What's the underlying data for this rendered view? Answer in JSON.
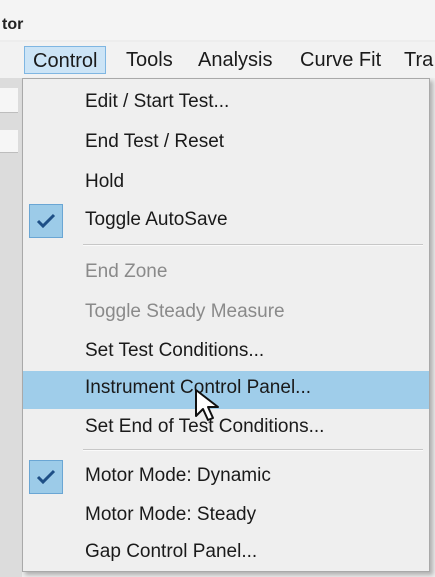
{
  "window": {
    "title_fragment": "tor"
  },
  "menubar": {
    "items": [
      {
        "label": "Control",
        "active": true
      },
      {
        "label": "Tools"
      },
      {
        "label": "Analysis"
      },
      {
        "label": "Curve Fit"
      },
      {
        "label": "Tra"
      }
    ]
  },
  "control_menu": {
    "items": [
      {
        "label": "Edit / Start Test...",
        "enabled": true
      },
      {
        "label": "End Test / Reset",
        "enabled": true
      },
      {
        "label": "Hold",
        "enabled": true
      },
      {
        "label": "Toggle AutoSave",
        "enabled": true,
        "checked": true
      },
      {
        "label": "End Zone",
        "enabled": false
      },
      {
        "label": "Toggle Steady Measure",
        "enabled": false
      },
      {
        "label": "Set Test Conditions...",
        "enabled": true
      },
      {
        "label": "Instrument Control Panel...",
        "enabled": true,
        "highlighted": true
      },
      {
        "label": "Set End of Test Conditions...",
        "enabled": true
      },
      {
        "label": "Motor Mode: Dynamic",
        "enabled": true,
        "checked": true
      },
      {
        "label": "Motor Mode: Steady",
        "enabled": true
      },
      {
        "label": "Gap Control Panel...",
        "enabled": true
      }
    ]
  },
  "icons": {
    "check": "checkmark-icon",
    "pointer": "mouse-pointer-icon"
  },
  "colors": {
    "highlight": "#9fcdea",
    "check_background": "#9ccbe8",
    "active_menu": "#cce4f6",
    "disabled_text": "#8a8a8a"
  }
}
